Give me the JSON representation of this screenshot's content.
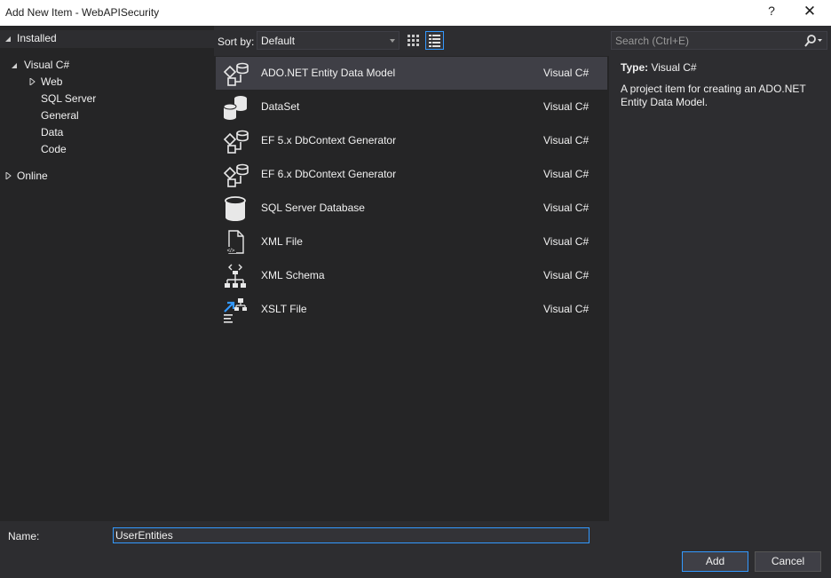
{
  "window": {
    "title": "Add New Item - WebAPISecurity",
    "help_label": "?",
    "close_label": "✕"
  },
  "tree": {
    "installed": "Installed",
    "visual_csharp": "Visual C#",
    "children": [
      "Web",
      "SQL Server",
      "General",
      "Data",
      "Code"
    ],
    "online": "Online"
  },
  "sort": {
    "label": "Sort by:",
    "value": "Default"
  },
  "templates": [
    {
      "name": "ADO.NET Entity Data Model",
      "lang": "Visual C#",
      "icon": "entity-model-icon"
    },
    {
      "name": "DataSet",
      "lang": "Visual C#",
      "icon": "dataset-icon"
    },
    {
      "name": "EF 5.x DbContext Generator",
      "lang": "Visual C#",
      "icon": "ef-generator-icon"
    },
    {
      "name": "EF 6.x DbContext Generator",
      "lang": "Visual C#",
      "icon": "ef-generator-icon"
    },
    {
      "name": "SQL Server Database",
      "lang": "Visual C#",
      "icon": "database-icon"
    },
    {
      "name": "XML File",
      "lang": "Visual C#",
      "icon": "xml-file-icon"
    },
    {
      "name": "XML Schema",
      "lang": "Visual C#",
      "icon": "xml-schema-icon"
    },
    {
      "name": "XSLT File",
      "lang": "Visual C#",
      "icon": "xslt-file-icon"
    }
  ],
  "search": {
    "placeholder": "Search (Ctrl+E)"
  },
  "details": {
    "type_label": "Type:",
    "type_value": "Visual C#",
    "description": "A project item for creating an ADO.NET Entity Data Model."
  },
  "form": {
    "name_label": "Name:",
    "name_value": "UserEntities"
  },
  "buttons": {
    "add": "Add",
    "cancel": "Cancel"
  },
  "colors": {
    "accent": "#3399ff",
    "background": "#2d2d30",
    "list_background": "#252526",
    "selected_row": "#3f3f46"
  }
}
